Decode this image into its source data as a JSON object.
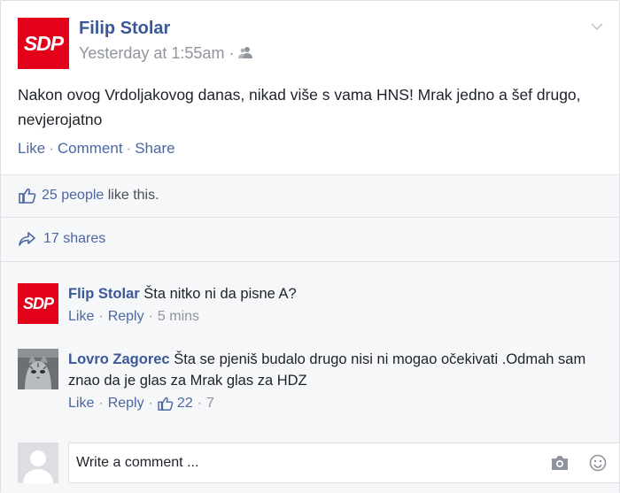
{
  "post": {
    "author": "Filip Stolar",
    "logo_text": "SDP",
    "timestamp": "Yesterday at 1:55am",
    "dot": "·",
    "text": "Nakon ovog Vrdoljakovog danas, nikad više s vama HNS! Mrak jedno a šef drugo, nevjerojatno",
    "actions": {
      "like": "Like",
      "comment": "Comment",
      "share": "Share",
      "sep": "·"
    }
  },
  "likes": {
    "count_link": "25 people",
    "suffix": " like this."
  },
  "shares": {
    "label": "17 shares"
  },
  "comments": [
    {
      "author": "Flip Stolar",
      "text": "Šta nitko ni da pisne A?",
      "like": "Like",
      "reply": "Reply",
      "time": "5 mins",
      "sep": "·"
    },
    {
      "author": "Lovro Zagorec",
      "text": "Šta se pjeniš budalo drugo nisi ni mogao očekivati .Odmah sam znao da je glas za Mrak glas za HDZ",
      "like": "Like",
      "reply": "Reply",
      "likes": "22",
      "time": "7",
      "sep": "·"
    }
  ],
  "composer": {
    "placeholder": "Write a comment ..."
  },
  "colors": {
    "brand_link": "#3b5998",
    "sdp_red": "#e2001a",
    "muted": "#90949c"
  }
}
